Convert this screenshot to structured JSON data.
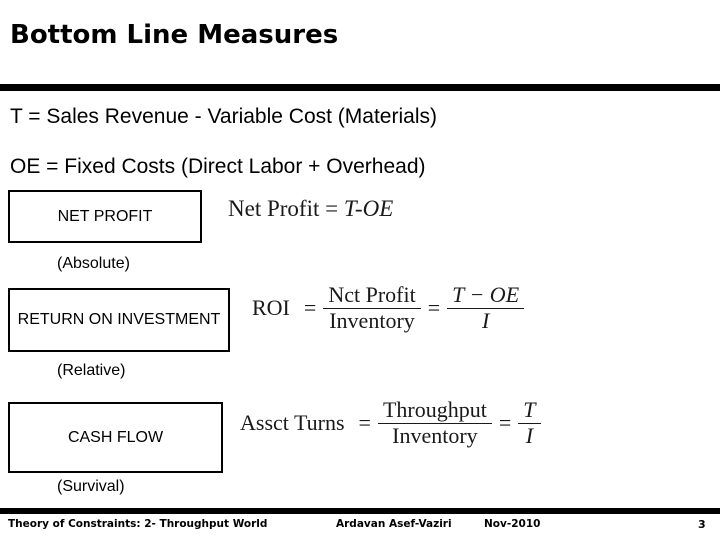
{
  "slide": {
    "title": "Bottom Line Measures",
    "definitions": [
      {
        "id": "throughput",
        "text": "T  = Sales Revenue - Variable Cost (Materials)"
      },
      {
        "id": "operating-expense",
        "text": "OE = Fixed Costs (Direct Labor  + Overhead)"
      }
    ],
    "measures": [
      {
        "id": "net-profit",
        "box_label": "NET PROFIT",
        "caption": "(Absolute)",
        "equation": {
          "lhs": "Net Profit",
          "eq": "=",
          "rhs": "T-OE"
        }
      },
      {
        "id": "return-on-investment",
        "box_label": "RETURN ON INVESTMENT",
        "caption": "(Relative)",
        "equation": {
          "lhs": "ROI",
          "eq1": "=",
          "frac1_num": "Nct Profit",
          "frac1_den": "Inventory",
          "eq2": "=",
          "frac2_num": "T − OE",
          "frac2_den": "I"
        }
      },
      {
        "id": "cash-flow",
        "box_label": "CASH FLOW",
        "caption": "(Survival)",
        "equation": {
          "lhs": "Assct Turns",
          "eq1": "=",
          "frac1_num": "Throughput",
          "frac1_den": "Inventory",
          "eq2": "=",
          "frac2_num": "T",
          "frac2_den": "I"
        }
      }
    ]
  },
  "footer": {
    "course": "Theory of Constraints:  2- Throughput World",
    "author": "Ardavan Asef-Vaziri",
    "date": "Nov-2010",
    "page_number": "3"
  }
}
